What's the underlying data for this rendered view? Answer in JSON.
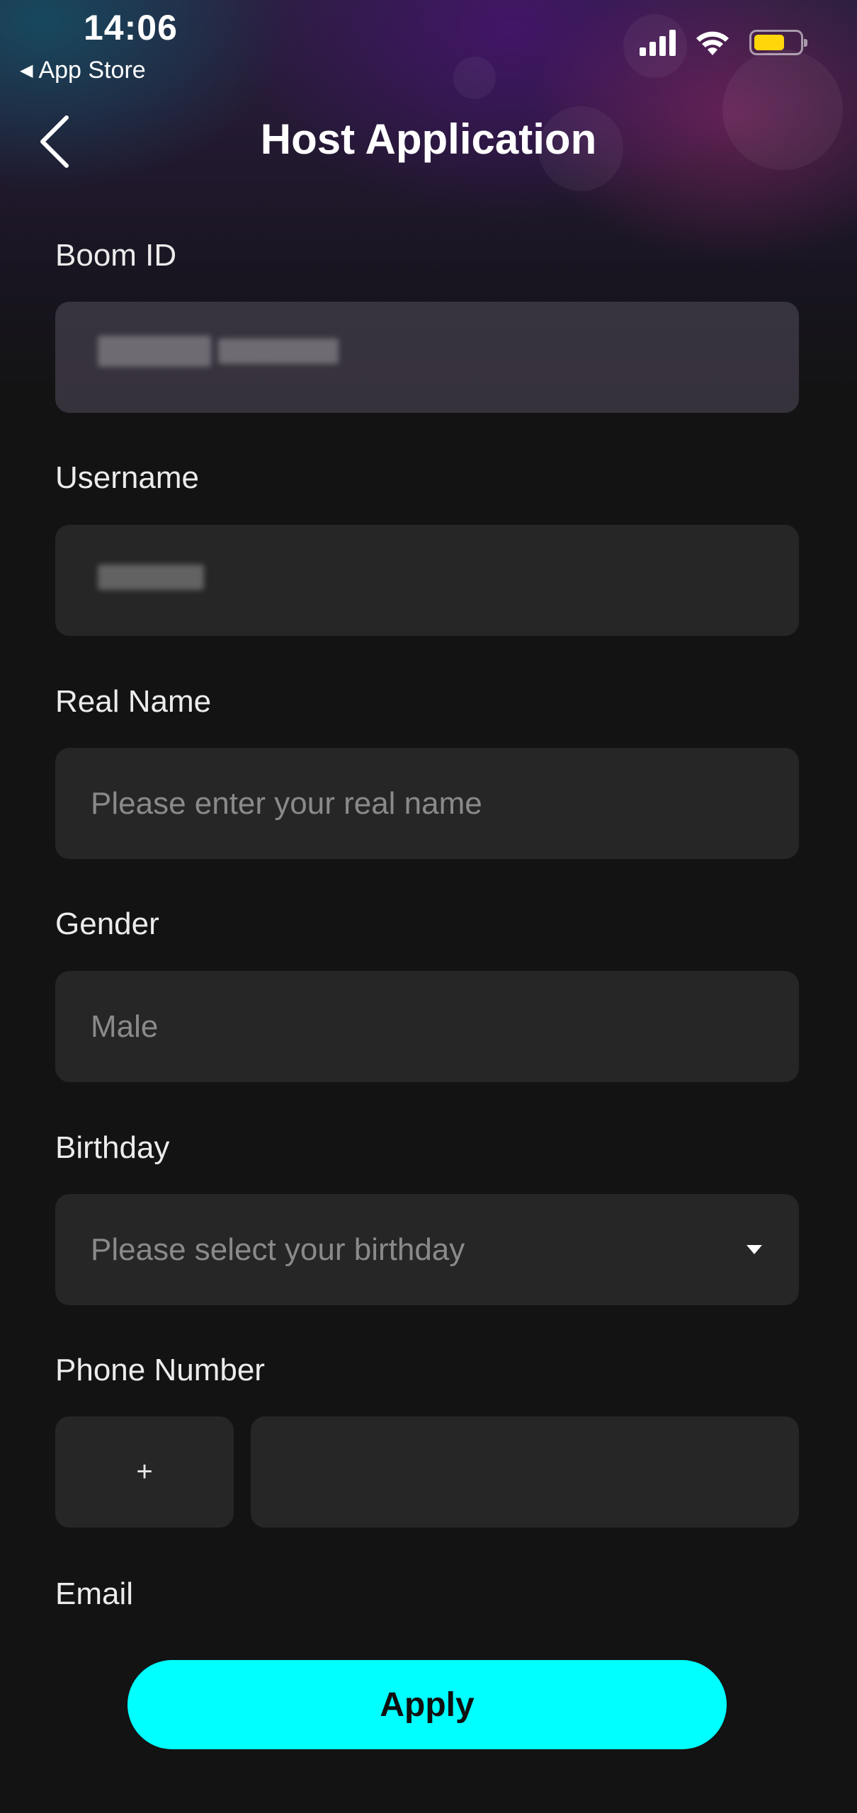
{
  "status_bar": {
    "time": "14:06",
    "back_app_label": "App Store",
    "battery_color": "#ffd60a"
  },
  "header": {
    "title": "Host Application",
    "back_icon": "chevron-left-icon"
  },
  "form": {
    "boom_id": {
      "label": "Boom ID",
      "value": ""
    },
    "username": {
      "label": "Username",
      "value": ""
    },
    "real_name": {
      "label": "Real Name",
      "placeholder": "Please enter your real name"
    },
    "gender": {
      "label": "Gender",
      "value": "Male"
    },
    "birthday": {
      "label": "Birthday",
      "placeholder": "Please select your birthday",
      "icon": "caret-down-icon"
    },
    "phone": {
      "label": "Phone Number",
      "country_code": "+",
      "value": ""
    },
    "email": {
      "label": "Email"
    }
  },
  "actions": {
    "apply_label": "Apply",
    "apply_color": "#00ffff"
  }
}
